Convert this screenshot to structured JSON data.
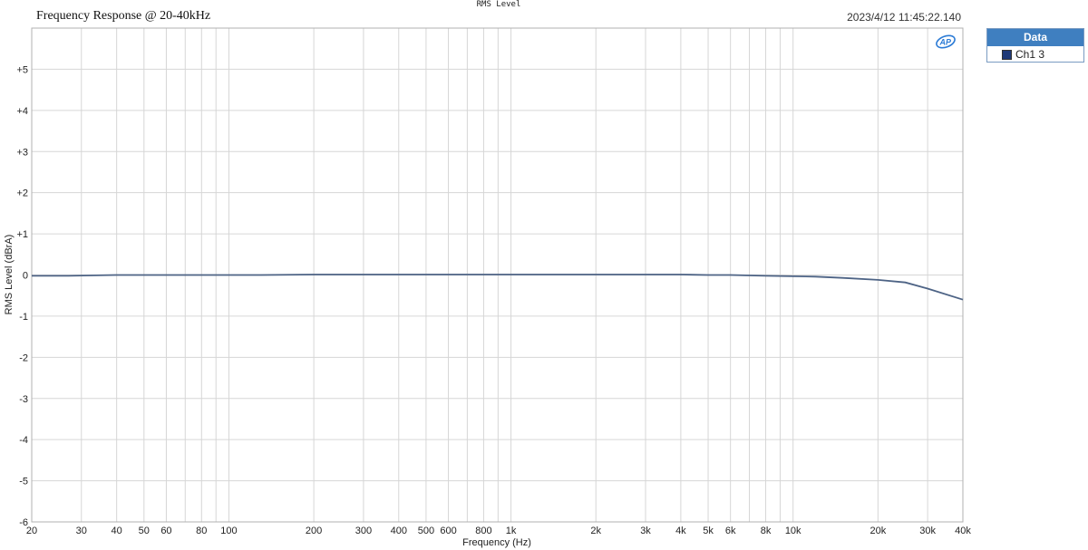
{
  "header": {
    "top_title": "RMS Level",
    "chart_title": "Frequency Response @ 20-40kHz",
    "timestamp": "2023/4/12 11:45:22.140"
  },
  "legend": {
    "header": "Data",
    "items": [
      {
        "label": "Ch1 3",
        "color": "#1f3a78"
      }
    ]
  },
  "logo": {
    "icon": "ap-logo-icon",
    "color": "#2b7bd6"
  },
  "chart_data": {
    "type": "line",
    "xlabel": "Frequency (Hz)",
    "ylabel": "RMS Level (dBrA)",
    "xscale": "log",
    "xlim": [
      20,
      40000
    ],
    "ylim": [
      -6,
      6
    ],
    "grid": true,
    "legend_position": "right-outside",
    "x_ticks": [
      20,
      30,
      40,
      50,
      60,
      80,
      100,
      200,
      300,
      400,
      500,
      600,
      800,
      1000,
      2000,
      3000,
      4000,
      5000,
      6000,
      8000,
      10000,
      20000,
      30000,
      40000
    ],
    "x_tick_labels": [
      "20",
      "30",
      "40",
      "50",
      "60",
      "80",
      "100",
      "200",
      "300",
      "400",
      "500",
      "600",
      "800",
      "1k",
      "2k",
      "3k",
      "4k",
      "5k",
      "6k",
      "8k",
      "10k",
      "20k",
      "30k",
      "40k"
    ],
    "x_minor_ticks": [
      70,
      90,
      700,
      900,
      7000,
      9000
    ],
    "y_ticks": [
      6,
      5,
      4,
      3,
      2,
      1,
      0,
      -1,
      -2,
      -3,
      -4,
      -5,
      -6
    ],
    "y_tick_labels": [
      "",
      "+5",
      "+4",
      "+3",
      "+2",
      "+1",
      "0",
      "-1",
      "-2",
      "-3",
      "-4",
      "-5",
      "-6"
    ],
    "series": [
      {
        "name": "Ch1 3",
        "color": "#4d6385",
        "x": [
          20,
          27,
          40,
          60,
          100,
          130,
          200,
          400,
          1000,
          2000,
          4000,
          5000,
          6000,
          8000,
          10000,
          12000,
          15000,
          20000,
          25000,
          30000,
          40000
        ],
        "values": [
          -0.02,
          -0.02,
          0.0,
          0.0,
          0.0,
          0.0,
          0.01,
          0.01,
          0.01,
          0.01,
          0.01,
          0.0,
          0.0,
          -0.02,
          -0.03,
          -0.04,
          -0.07,
          -0.12,
          -0.18,
          -0.33,
          -0.6
        ]
      }
    ]
  }
}
